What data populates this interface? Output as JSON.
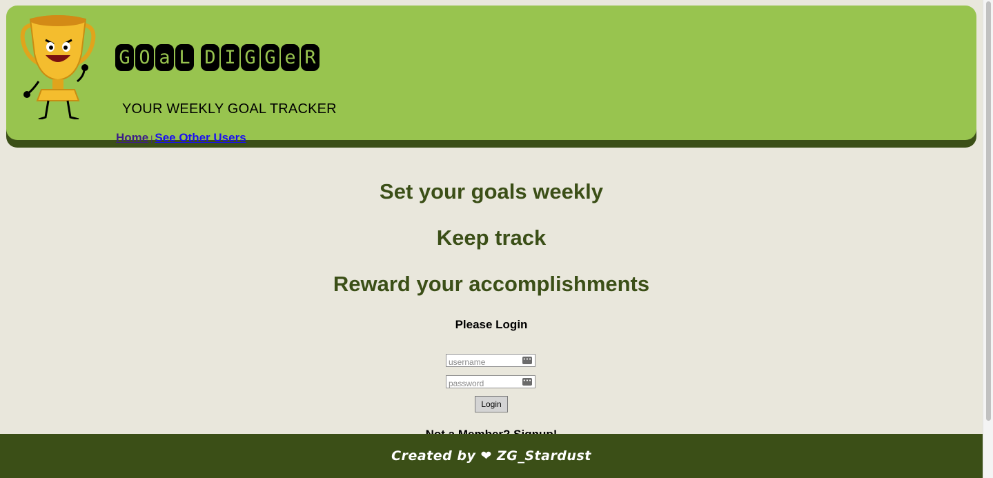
{
  "header": {
    "logo_letters": [
      "G",
      "O",
      "a",
      "L",
      " ",
      "D",
      "I",
      "G",
      "G",
      "e",
      "R"
    ],
    "tagline": "YOUR WEEKLY GOAL TRACKER",
    "nav": {
      "home": "Home",
      "separator": "|",
      "others": "See Other Users"
    }
  },
  "main": {
    "headings": [
      "Set your goals weekly",
      "Keep track",
      "Reward your accomplishments"
    ],
    "login_prompt": "Please Login",
    "username_placeholder": "username",
    "password_placeholder": "password",
    "login_button": "Login",
    "signup_text": "Not a Member? Signup!"
  },
  "footer": {
    "text": "Created by ❤ ZG_Stardust"
  },
  "colors": {
    "header_green": "#98c44f",
    "dark_green": "#3b4f17",
    "background": "#e9e7dc"
  },
  "icons": [
    "trophy-mascot-icon",
    "password-key-icon"
  ]
}
